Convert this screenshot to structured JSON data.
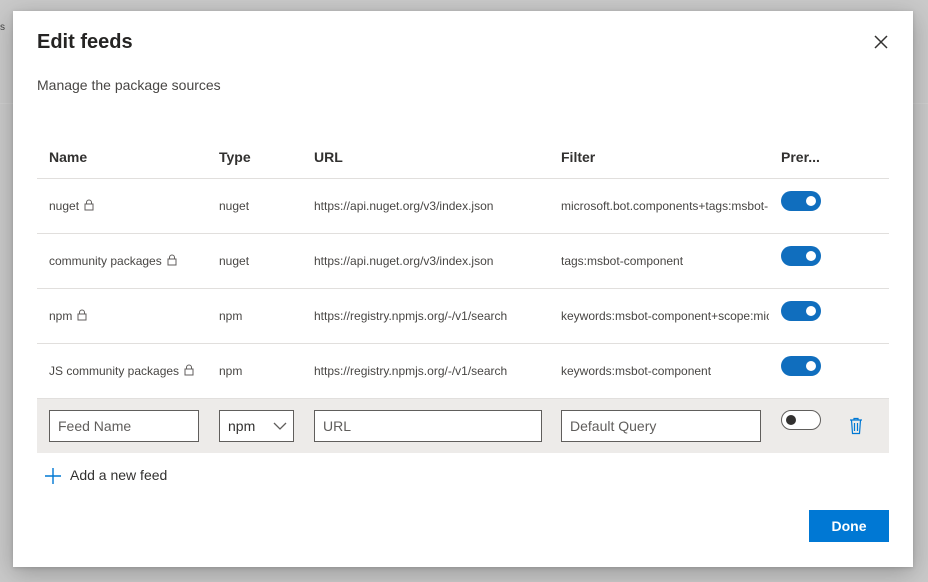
{
  "dialog": {
    "title": "Edit feeds",
    "subtitle": "Manage the package sources",
    "close_icon": "close-icon"
  },
  "table": {
    "headers": [
      "Name",
      "Type",
      "URL",
      "Filter",
      "Prer..."
    ],
    "rows": [
      {
        "name": "nuget",
        "type": "nuget",
        "url": "https://api.nuget.org/v3/index.json",
        "filter": "microsoft.bot.components+tags:msbot-",
        "prerelease": true,
        "locked": true
      },
      {
        "name": "community packages",
        "type": "nuget",
        "url": "https://api.nuget.org/v3/index.json",
        "filter": "tags:msbot-component",
        "prerelease": true,
        "locked": true
      },
      {
        "name": "npm",
        "type": "npm",
        "url": "https://registry.npmjs.org/-/v1/search",
        "filter": "keywords:msbot-component+scope:mic",
        "prerelease": true,
        "locked": true
      },
      {
        "name": "JS community packages",
        "type": "npm",
        "url": "https://registry.npmjs.org/-/v1/search",
        "filter": "keywords:msbot-component",
        "prerelease": true,
        "locked": true
      }
    ]
  },
  "new_feed": {
    "name_placeholder": "Feed Name",
    "type_value": "npm",
    "url_placeholder": "URL",
    "filter_placeholder": "Default Query",
    "prerelease": false
  },
  "actions": {
    "add_label": "Add a new feed",
    "done_label": "Done"
  },
  "colors": {
    "accent": "#0078d4",
    "toggle_on": "#106ebe",
    "new_row_bg": "#edebe9"
  }
}
